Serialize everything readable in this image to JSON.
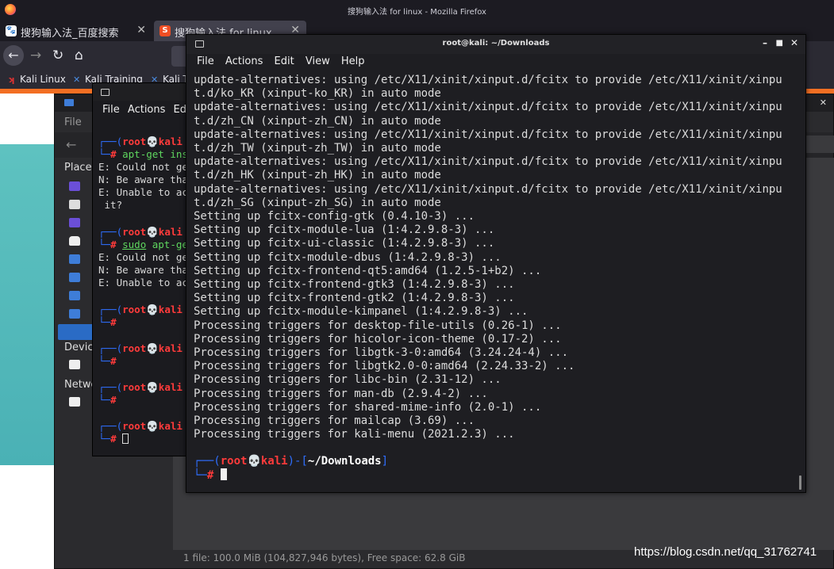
{
  "firefox": {
    "title": "搜狗输入法 for linux - Mozilla Firefox",
    "tabs": [
      {
        "label": "搜狗输入法_百度搜索",
        "icon": "baidu-icon"
      },
      {
        "label": "搜狗输入法 for linux",
        "icon": "sogou-icon"
      }
    ],
    "bookmarks": [
      "Kali Linux",
      "Kali Training",
      "Kali T"
    ]
  },
  "file_manager": {
    "menu_label": "File",
    "sidebar": {
      "places": "Places",
      "devices": "Device",
      "network": "Netwo"
    },
    "status": "1 file: 100.0 MiB (104,827,946 bytes), Free space: 62.8 GiB"
  },
  "small_terminal": {
    "menu": [
      "File",
      "Actions",
      "Edi"
    ],
    "lines": {
      "p1_user": "root",
      "p1_host": "kali",
      "p1_cmd": "apt-get ins",
      "e1": "E: Could not ge",
      "n1": "N: Be aware tha",
      "e2": "E: Unable to ac",
      "e2b": " it?",
      "p2_cmd_sudo": "sudo",
      "p2_cmd": " apt-ge",
      "e3": "E: Could not ge",
      "n2": "N: Be aware tha",
      "e4": "E: Unable to ac"
    }
  },
  "terminal": {
    "title": "root@kali: ~/Downloads",
    "menu": [
      "File",
      "Actions",
      "Edit",
      "View",
      "Help"
    ],
    "output": [
      "update-alternatives: using /etc/X11/xinit/xinput.d/fcitx to provide /etc/X11/xinit/xinpu",
      "t.d/ko_KR (xinput-ko_KR) in auto mode",
      "update-alternatives: using /etc/X11/xinit/xinput.d/fcitx to provide /etc/X11/xinit/xinpu",
      "t.d/zh_CN (xinput-zh_CN) in auto mode",
      "update-alternatives: using /etc/X11/xinit/xinput.d/fcitx to provide /etc/X11/xinit/xinpu",
      "t.d/zh_TW (xinput-zh_TW) in auto mode",
      "update-alternatives: using /etc/X11/xinit/xinput.d/fcitx to provide /etc/X11/xinit/xinpu",
      "t.d/zh_HK (xinput-zh_HK) in auto mode",
      "update-alternatives: using /etc/X11/xinit/xinput.d/fcitx to provide /etc/X11/xinit/xinpu",
      "t.d/zh_SG (xinput-zh_SG) in auto mode",
      "Setting up fcitx-config-gtk (0.4.10-3) ...",
      "Setting up fcitx-module-lua (1:4.2.9.8-3) ...",
      "Setting up fcitx-ui-classic (1:4.2.9.8-3) ...",
      "Setting up fcitx-module-dbus (1:4.2.9.8-3) ...",
      "Setting up fcitx-frontend-qt5:amd64 (1.2.5-1+b2) ...",
      "Setting up fcitx-frontend-gtk3 (1:4.2.9.8-3) ...",
      "Setting up fcitx-frontend-gtk2 (1:4.2.9.8-3) ...",
      "Setting up fcitx-module-kimpanel (1:4.2.9.8-3) ...",
      "Processing triggers for desktop-file-utils (0.26-1) ...",
      "Processing triggers for hicolor-icon-theme (0.17-2) ...",
      "Processing triggers for libgtk-3-0:amd64 (3.24.24-4) ...",
      "Processing triggers for libgtk2.0-0:amd64 (2.24.33-2) ...",
      "Processing triggers for libc-bin (2.31-12) ...",
      "Processing triggers for man-db (2.9.4-2) ...",
      "Processing triggers for shared-mime-info (2.0-1) ...",
      "Processing triggers for mailcap (3.69) ...",
      "Processing triggers for kali-menu (2021.2.3) ..."
    ],
    "prompt": {
      "user": "root",
      "host": "kali",
      "cwd": "~/Downloads",
      "symbol": "#"
    }
  },
  "watermark": "https://blog.csdn.net/qq_31762741"
}
